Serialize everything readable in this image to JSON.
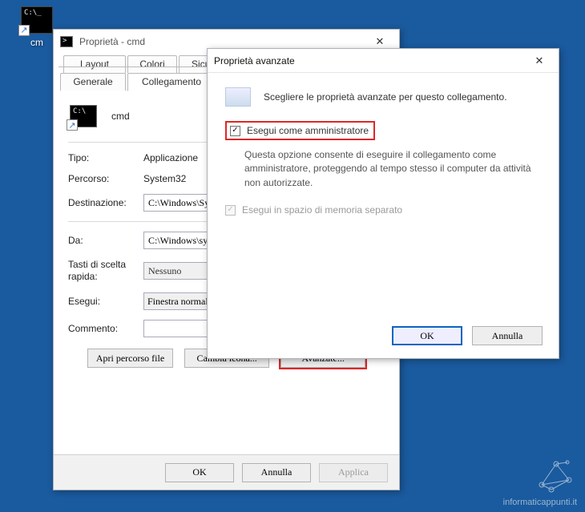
{
  "desktop": {
    "shortcut_label": "cm"
  },
  "propWindow": {
    "title": "Proprietà - cmd",
    "tabs": {
      "layout": "Layout",
      "colori": "Colori",
      "sicurezza": "Sicurezz",
      "generale": "Generale",
      "collegamento": "Collegamento"
    },
    "appName": "cmd",
    "rows": {
      "tipo_label": "Tipo:",
      "tipo_value": "Applicazione",
      "percorso_label": "Percorso:",
      "percorso_value": "System32",
      "destinazione_label": "Destinazione:",
      "destinazione_value": "C:\\Windows\\Sys",
      "da_label": "Da:",
      "da_value": "C:\\Windows\\syst",
      "tasti_label": "Tasti di scelta rapida:",
      "tasti_value": "Nessuno",
      "esegui_label": "Esegui:",
      "esegui_value": "Finestra normale",
      "commento_label": "Commento:",
      "commento_value": ""
    },
    "buttons": {
      "apri": "Apri percorso file",
      "cambia": "Cambia icona...",
      "avanzate": "Avanzate..."
    },
    "footer": {
      "ok": "OK",
      "annulla": "Annulla",
      "applica": "Applica"
    }
  },
  "advWindow": {
    "title": "Proprietà avanzate",
    "intro": "Scegliere le proprietà avanzate per questo collegamento.",
    "runAsAdmin_label": "Esegui come amministratore",
    "runAsAdmin_desc": "Questa opzione consente di eseguire il collegamento come amministratore, proteggendo al tempo stesso il computer da attività non autorizzate.",
    "memSpace_label": "Esegui in spazio di memoria separato",
    "ok": "OK",
    "cancel": "Annulla"
  },
  "watermark": "informaticappunti.it"
}
